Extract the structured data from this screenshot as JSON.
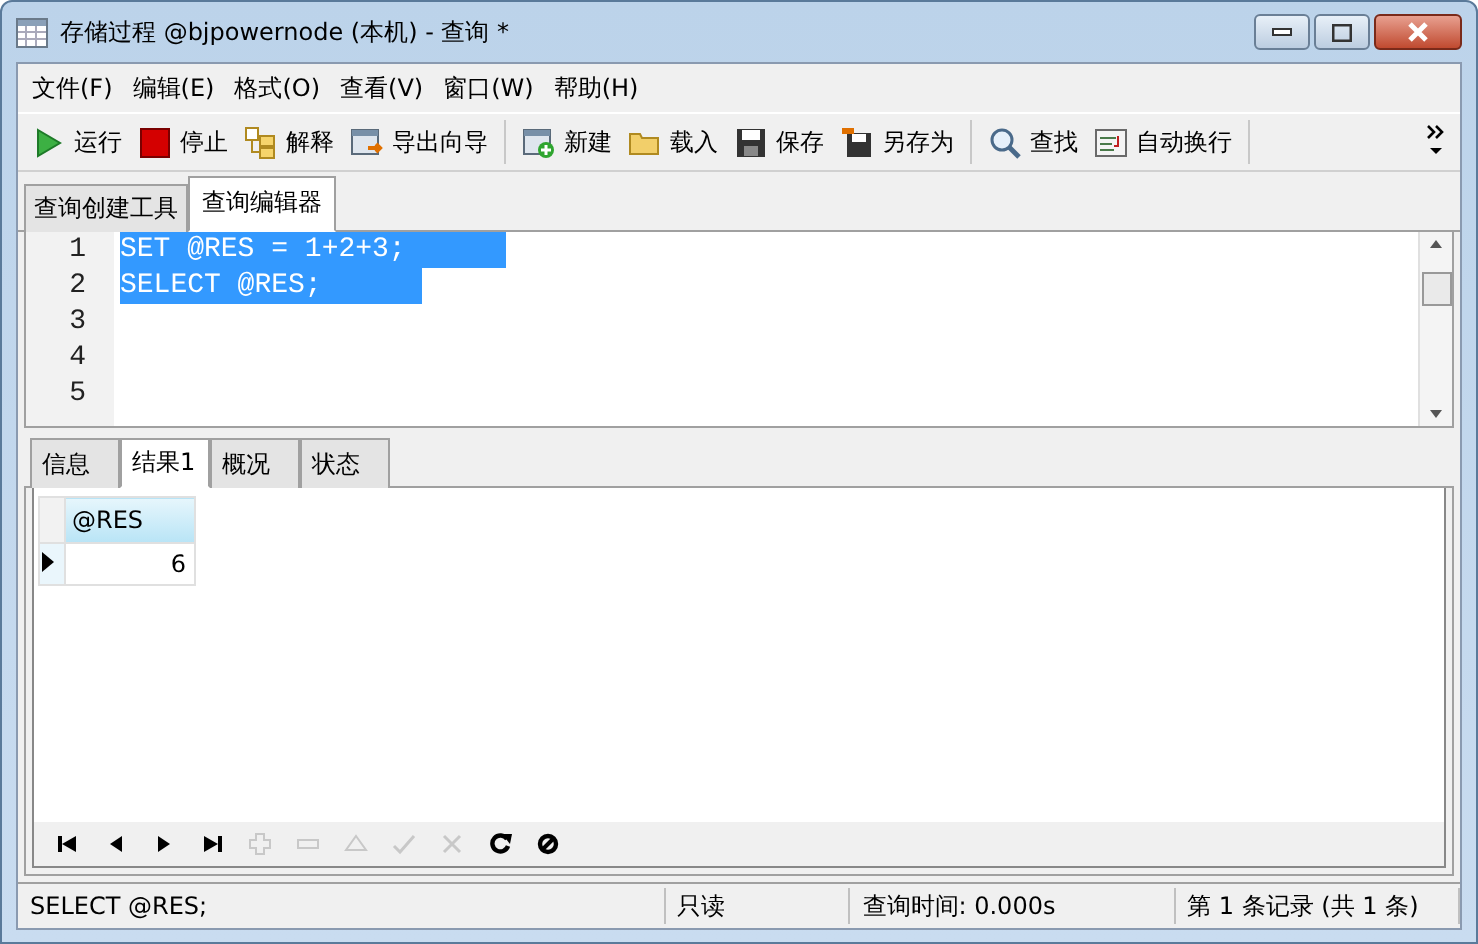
{
  "window": {
    "title": "存储过程 @bjpowernode (本机) - 查询 *"
  },
  "menu": [
    "文件(F)",
    "编辑(E)",
    "格式(O)",
    "查看(V)",
    "窗口(W)",
    "帮助(H)"
  ],
  "toolbar": [
    {
      "kind": "run",
      "label": "运行"
    },
    {
      "kind": "stop",
      "label": "停止"
    },
    {
      "kind": "explain",
      "label": "解释"
    },
    {
      "kind": "export",
      "label": "导出向导"
    },
    {
      "kind": "sep"
    },
    {
      "kind": "new",
      "label": "新建"
    },
    {
      "kind": "open",
      "label": "载入"
    },
    {
      "kind": "save",
      "label": "保存"
    },
    {
      "kind": "saveas",
      "label": "另存为"
    },
    {
      "kind": "sep"
    },
    {
      "kind": "find",
      "label": "查找"
    },
    {
      "kind": "wrap",
      "label": "自动换行"
    },
    {
      "kind": "sep"
    }
  ],
  "tabs": [
    {
      "label": "查询创建工具",
      "selected": false
    },
    {
      "label": "查询编辑器",
      "selected": true
    }
  ],
  "editor": {
    "lines": [
      {
        "number": "1",
        "code": "SET @RES = 1+2+3;",
        "selected": true
      },
      {
        "number": "2",
        "code": "SELECT @RES;",
        "selected": true
      },
      {
        "number": "3"
      },
      {
        "number": "4"
      },
      {
        "number": "5"
      }
    ]
  },
  "result_tabs": [
    {
      "label": "信息",
      "selected": false
    },
    {
      "label": "结果1",
      "selected": true
    },
    {
      "label": "概况",
      "selected": false
    },
    {
      "label": "状态",
      "selected": false
    }
  ],
  "grid": {
    "columns": [
      "@RES"
    ],
    "rows": [
      {
        "cells": [
          "6"
        ],
        "selected": true
      }
    ]
  },
  "navigator": [
    {
      "kind": "first",
      "disabled": false
    },
    {
      "kind": "prev",
      "disabled": false
    },
    {
      "kind": "next",
      "disabled": false
    },
    {
      "kind": "last",
      "disabled": false
    },
    {
      "kind": "add",
      "disabled": true
    },
    {
      "kind": "delete",
      "disabled": true
    },
    {
      "kind": "up",
      "disabled": true
    },
    {
      "kind": "apply",
      "disabled": true
    },
    {
      "kind": "cancel",
      "disabled": true
    },
    {
      "kind": "refresh",
      "disabled": false
    },
    {
      "kind": "stop",
      "disabled": false
    }
  ],
  "status_bar": [
    "SELECT @RES;",
    "只读",
    "查询时间: 0.000s",
    "第 1 条记录 (共 1 条)"
  ]
}
